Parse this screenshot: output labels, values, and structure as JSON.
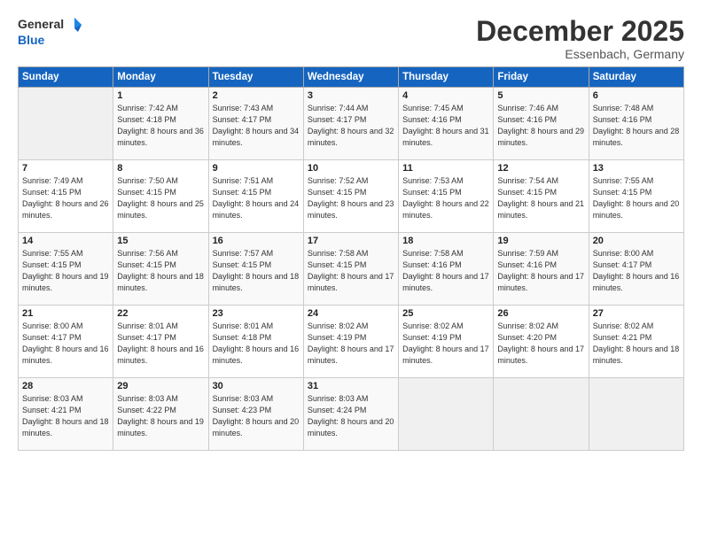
{
  "header": {
    "logo_general": "General",
    "logo_blue": "Blue",
    "title": "December 2025",
    "location": "Essenbach, Germany"
  },
  "days_of_week": [
    "Sunday",
    "Monday",
    "Tuesday",
    "Wednesday",
    "Thursday",
    "Friday",
    "Saturday"
  ],
  "weeks": [
    [
      {
        "day": "",
        "sunrise": "",
        "sunset": "",
        "daylight": "",
        "empty": true
      },
      {
        "day": "1",
        "sunrise": "Sunrise: 7:42 AM",
        "sunset": "Sunset: 4:18 PM",
        "daylight": "Daylight: 8 hours and 36 minutes."
      },
      {
        "day": "2",
        "sunrise": "Sunrise: 7:43 AM",
        "sunset": "Sunset: 4:17 PM",
        "daylight": "Daylight: 8 hours and 34 minutes."
      },
      {
        "day": "3",
        "sunrise": "Sunrise: 7:44 AM",
        "sunset": "Sunset: 4:17 PM",
        "daylight": "Daylight: 8 hours and 32 minutes."
      },
      {
        "day": "4",
        "sunrise": "Sunrise: 7:45 AM",
        "sunset": "Sunset: 4:16 PM",
        "daylight": "Daylight: 8 hours and 31 minutes."
      },
      {
        "day": "5",
        "sunrise": "Sunrise: 7:46 AM",
        "sunset": "Sunset: 4:16 PM",
        "daylight": "Daylight: 8 hours and 29 minutes."
      },
      {
        "day": "6",
        "sunrise": "Sunrise: 7:48 AM",
        "sunset": "Sunset: 4:16 PM",
        "daylight": "Daylight: 8 hours and 28 minutes."
      }
    ],
    [
      {
        "day": "7",
        "sunrise": "Sunrise: 7:49 AM",
        "sunset": "Sunset: 4:15 PM",
        "daylight": "Daylight: 8 hours and 26 minutes."
      },
      {
        "day": "8",
        "sunrise": "Sunrise: 7:50 AM",
        "sunset": "Sunset: 4:15 PM",
        "daylight": "Daylight: 8 hours and 25 minutes."
      },
      {
        "day": "9",
        "sunrise": "Sunrise: 7:51 AM",
        "sunset": "Sunset: 4:15 PM",
        "daylight": "Daylight: 8 hours and 24 minutes."
      },
      {
        "day": "10",
        "sunrise": "Sunrise: 7:52 AM",
        "sunset": "Sunset: 4:15 PM",
        "daylight": "Daylight: 8 hours and 23 minutes."
      },
      {
        "day": "11",
        "sunrise": "Sunrise: 7:53 AM",
        "sunset": "Sunset: 4:15 PM",
        "daylight": "Daylight: 8 hours and 22 minutes."
      },
      {
        "day": "12",
        "sunrise": "Sunrise: 7:54 AM",
        "sunset": "Sunset: 4:15 PM",
        "daylight": "Daylight: 8 hours and 21 minutes."
      },
      {
        "day": "13",
        "sunrise": "Sunrise: 7:55 AM",
        "sunset": "Sunset: 4:15 PM",
        "daylight": "Daylight: 8 hours and 20 minutes."
      }
    ],
    [
      {
        "day": "14",
        "sunrise": "Sunrise: 7:55 AM",
        "sunset": "Sunset: 4:15 PM",
        "daylight": "Daylight: 8 hours and 19 minutes."
      },
      {
        "day": "15",
        "sunrise": "Sunrise: 7:56 AM",
        "sunset": "Sunset: 4:15 PM",
        "daylight": "Daylight: 8 hours and 18 minutes."
      },
      {
        "day": "16",
        "sunrise": "Sunrise: 7:57 AM",
        "sunset": "Sunset: 4:15 PM",
        "daylight": "Daylight: 8 hours and 18 minutes."
      },
      {
        "day": "17",
        "sunrise": "Sunrise: 7:58 AM",
        "sunset": "Sunset: 4:15 PM",
        "daylight": "Daylight: 8 hours and 17 minutes."
      },
      {
        "day": "18",
        "sunrise": "Sunrise: 7:58 AM",
        "sunset": "Sunset: 4:16 PM",
        "daylight": "Daylight: 8 hours and 17 minutes."
      },
      {
        "day": "19",
        "sunrise": "Sunrise: 7:59 AM",
        "sunset": "Sunset: 4:16 PM",
        "daylight": "Daylight: 8 hours and 17 minutes."
      },
      {
        "day": "20",
        "sunrise": "Sunrise: 8:00 AM",
        "sunset": "Sunset: 4:17 PM",
        "daylight": "Daylight: 8 hours and 16 minutes."
      }
    ],
    [
      {
        "day": "21",
        "sunrise": "Sunrise: 8:00 AM",
        "sunset": "Sunset: 4:17 PM",
        "daylight": "Daylight: 8 hours and 16 minutes."
      },
      {
        "day": "22",
        "sunrise": "Sunrise: 8:01 AM",
        "sunset": "Sunset: 4:17 PM",
        "daylight": "Daylight: 8 hours and 16 minutes."
      },
      {
        "day": "23",
        "sunrise": "Sunrise: 8:01 AM",
        "sunset": "Sunset: 4:18 PM",
        "daylight": "Daylight: 8 hours and 16 minutes."
      },
      {
        "day": "24",
        "sunrise": "Sunrise: 8:02 AM",
        "sunset": "Sunset: 4:19 PM",
        "daylight": "Daylight: 8 hours and 17 minutes."
      },
      {
        "day": "25",
        "sunrise": "Sunrise: 8:02 AM",
        "sunset": "Sunset: 4:19 PM",
        "daylight": "Daylight: 8 hours and 17 minutes."
      },
      {
        "day": "26",
        "sunrise": "Sunrise: 8:02 AM",
        "sunset": "Sunset: 4:20 PM",
        "daylight": "Daylight: 8 hours and 17 minutes."
      },
      {
        "day": "27",
        "sunrise": "Sunrise: 8:02 AM",
        "sunset": "Sunset: 4:21 PM",
        "daylight": "Daylight: 8 hours and 18 minutes."
      }
    ],
    [
      {
        "day": "28",
        "sunrise": "Sunrise: 8:03 AM",
        "sunset": "Sunset: 4:21 PM",
        "daylight": "Daylight: 8 hours and 18 minutes."
      },
      {
        "day": "29",
        "sunrise": "Sunrise: 8:03 AM",
        "sunset": "Sunset: 4:22 PM",
        "daylight": "Daylight: 8 hours and 19 minutes."
      },
      {
        "day": "30",
        "sunrise": "Sunrise: 8:03 AM",
        "sunset": "Sunset: 4:23 PM",
        "daylight": "Daylight: 8 hours and 20 minutes."
      },
      {
        "day": "31",
        "sunrise": "Sunrise: 8:03 AM",
        "sunset": "Sunset: 4:24 PM",
        "daylight": "Daylight: 8 hours and 20 minutes."
      },
      {
        "day": "",
        "sunrise": "",
        "sunset": "",
        "daylight": "",
        "empty": true
      },
      {
        "day": "",
        "sunrise": "",
        "sunset": "",
        "daylight": "",
        "empty": true
      },
      {
        "day": "",
        "sunrise": "",
        "sunset": "",
        "daylight": "",
        "empty": true
      }
    ]
  ]
}
